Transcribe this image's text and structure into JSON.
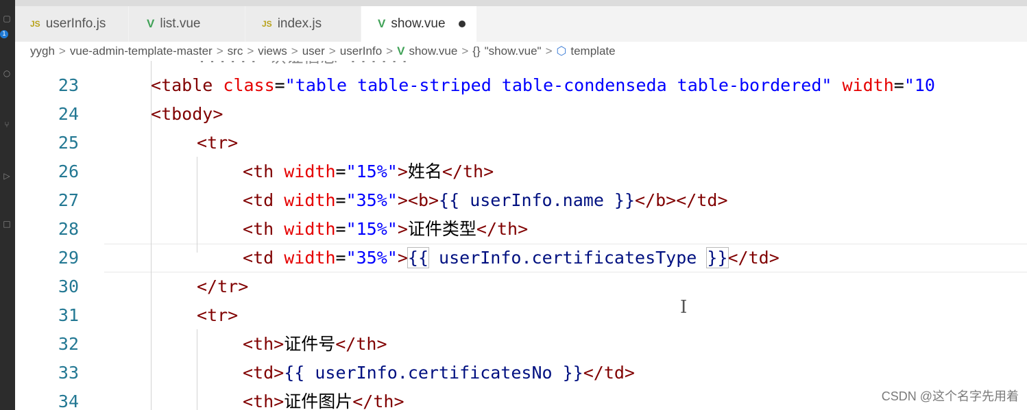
{
  "tabs": [
    {
      "label": "userInfo.js",
      "icon": "JS",
      "active": false
    },
    {
      "label": "list.vue",
      "icon": "V",
      "active": false
    },
    {
      "label": "index.js",
      "icon": "JS",
      "active": false
    },
    {
      "label": "show.vue",
      "icon": "V",
      "active": true,
      "dirty": true
    }
  ],
  "activity_bar": {
    "badge": "1"
  },
  "breadcrumb": {
    "items": [
      "yygh",
      "vue-admin-template-master",
      "src",
      "views",
      "user",
      "userInfo",
      "show.vue",
      "\"show.vue\"",
      "template"
    ],
    "separator": ">",
    "braces_icon": "{}"
  },
  "editor": {
    "partial_top_line": "...... 认证信息 ......",
    "line_numbers": [
      "23",
      "24",
      "25",
      "26",
      "27",
      "28",
      "29",
      "30",
      "31",
      "32",
      "33",
      "34"
    ],
    "current_line": "29",
    "lines": {
      "l23": {
        "open": "<",
        "tag": "table",
        "class_attr": "class",
        "eq": "=",
        "class_val": "\"table table-striped table-condenseda table-bordered\"",
        "width_attr": "width",
        "width_val": "\"10"
      },
      "l24": {
        "open": "<",
        "tag": "tbody",
        "close": ">"
      },
      "l25": {
        "open": "<",
        "tag": "tr",
        "close": ">"
      },
      "l26": {
        "tag": "th",
        "attr": "width",
        "val": "\"15%\"",
        "text": "姓名",
        "end": "</th>"
      },
      "l27": {
        "tag": "td",
        "attr": "width",
        "val": "\"35%\"",
        "b_open": "<b>",
        "expr": "{{ userInfo.name }}",
        "b_close": "</b>",
        "end": "</td>"
      },
      "l28": {
        "tag": "th",
        "attr": "width",
        "val": "\"15%\"",
        "text": "证件类型",
        "end": "</th>"
      },
      "l29": {
        "tag": "td",
        "attr": "width",
        "val": "\"35%\"",
        "expr_open": "{{",
        "expr_body": " userInfo.certificatesType ",
        "expr_close": "}}",
        "end": "</td>"
      },
      "l30": {
        "text": "</tr>"
      },
      "l31": {
        "open": "<",
        "tag": "tr",
        "close": ">"
      },
      "l32": {
        "start": "<th>",
        "text": "证件号",
        "end": "</th>"
      },
      "l33": {
        "start": "<td>",
        "expr": "{{ userInfo.certificatesNo }}",
        "end": "</td>"
      },
      "l34": {
        "start": "<th>",
        "text": "证件图片",
        "end": "</th>"
      }
    }
  },
  "watermark": "CSDN @这个名字先用着",
  "colors": {
    "tag": "#800000",
    "attribute": "#e50000",
    "string": "#0000ff",
    "line_number": "#237893",
    "variable": "#001080"
  }
}
